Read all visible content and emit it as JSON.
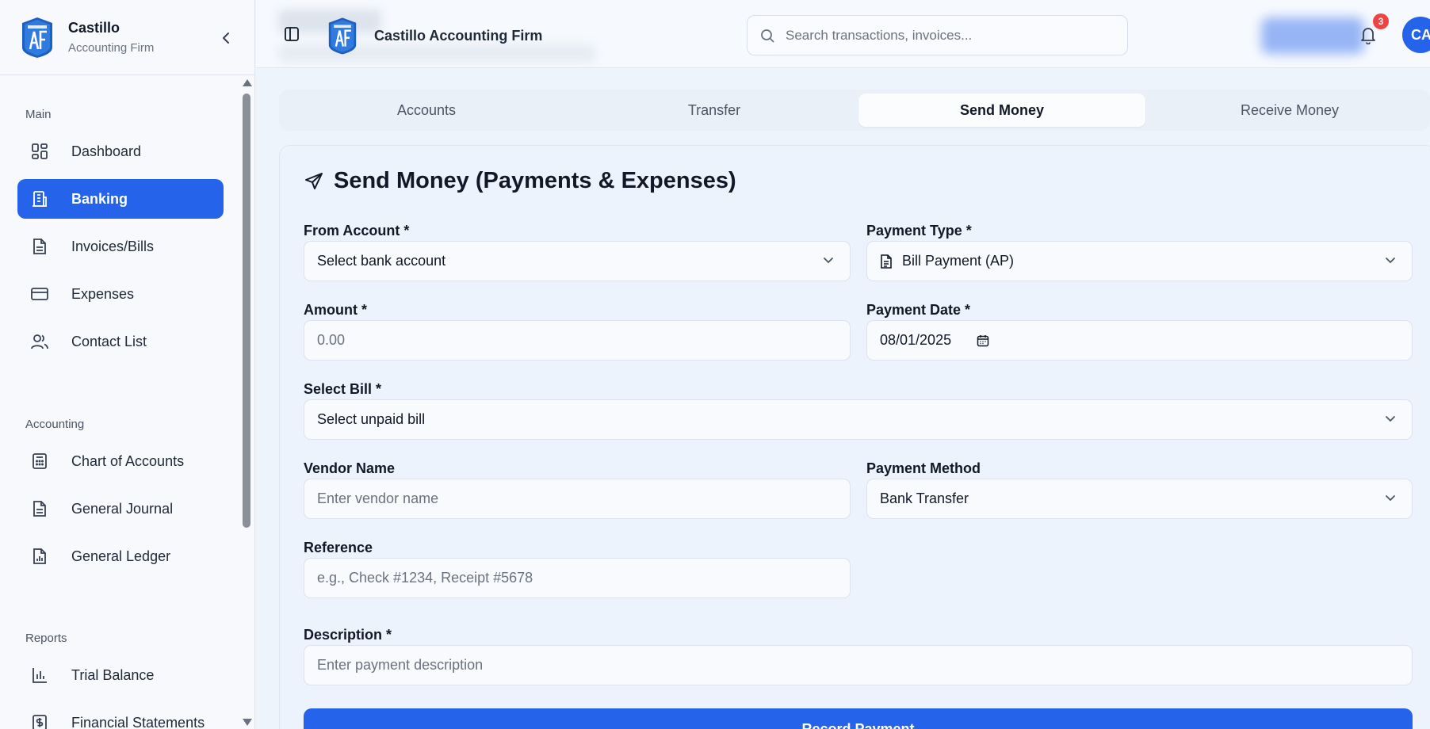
{
  "sidebar": {
    "brand_name": "Castillo",
    "brand_sub": "Accounting Firm",
    "sections": {
      "main": "Main",
      "accounting": "Accounting",
      "reports": "Reports"
    },
    "items": {
      "dashboard": "Dashboard",
      "banking": "Banking",
      "invoices": "Invoices/Bills",
      "expenses": "Expenses",
      "contacts": "Contact List",
      "chart_of_accounts": "Chart of Accounts",
      "general_journal": "General Journal",
      "general_ledger": "General Ledger",
      "trial_balance": "Trial Balance",
      "financial_statements": "Financial Statements"
    },
    "active_item": "Banking"
  },
  "header": {
    "title": "Castillo Accounting Firm",
    "search_placeholder": "Search transactions, invoices...",
    "notification_count": "3",
    "avatar_initials": "CA"
  },
  "tabs": {
    "accounts": "Accounts",
    "transfer": "Transfer",
    "send_money": "Send Money",
    "receive_money": "Receive Money",
    "active": "Send Money"
  },
  "form": {
    "title": "Send Money (Payments & Expenses)",
    "from_account_label": "From Account *",
    "from_account_value": "Select bank account",
    "payment_type_label": "Payment Type *",
    "payment_type_value": "Bill Payment (AP)",
    "amount_label": "Amount *",
    "amount_placeholder": "0.00",
    "payment_date_label": "Payment Date *",
    "payment_date_value": "08/01/2025",
    "select_bill_label": "Select Bill *",
    "select_bill_value": "Select unpaid bill",
    "vendor_name_label": "Vendor Name",
    "vendor_name_placeholder": "Enter vendor name",
    "payment_method_label": "Payment Method",
    "payment_method_value": "Bank Transfer",
    "reference_label": "Reference",
    "reference_placeholder": "e.g., Check #1234, Receipt #5678",
    "description_label": "Description *",
    "description_placeholder": "Enter payment description",
    "submit_label": "Record Payment"
  },
  "colors": {
    "accent": "#2563eb",
    "badge": "#ef4444",
    "background": "#eef4fc"
  },
  "icons": {
    "brand": "af-building-logo",
    "collapse": "chevron-left-icon",
    "sidebar_toggle": "panel-left-icon",
    "search": "search-icon",
    "notifications": "bell-icon",
    "title": "send-icon",
    "payment_type": "file-text-icon",
    "date": "calendar-icon"
  }
}
